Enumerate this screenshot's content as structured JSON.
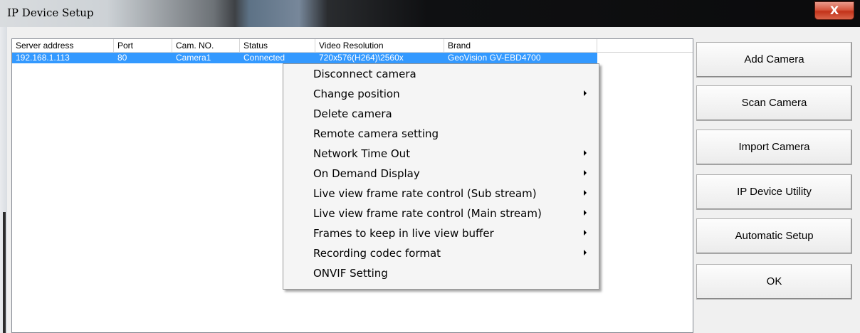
{
  "window": {
    "title": "IP Device Setup",
    "close_glyph": "X"
  },
  "list": {
    "columns": [
      "Server address",
      "Port",
      "Cam. NO.",
      "Status",
      "Video Resolution",
      "Brand"
    ],
    "rows": [
      {
        "server": "192.168.1.113",
        "port": "80",
        "cam": "Camera1",
        "status": "Connected",
        "resolution": "720x576(H264)\\2560x",
        "brand": "GeoVision GV-EBD4700"
      }
    ]
  },
  "context_menu": {
    "items": [
      {
        "label": "Disconnect camera",
        "submenu": false
      },
      {
        "label": "Change position",
        "submenu": true
      },
      {
        "label": "Delete camera",
        "submenu": false
      },
      {
        "label": "Remote camera setting",
        "submenu": false
      },
      {
        "label": "Network Time Out",
        "submenu": true
      },
      {
        "label": "On Demand Display",
        "submenu": true
      },
      {
        "label": "Live view frame rate control (Sub stream)",
        "submenu": true
      },
      {
        "label": "Live view frame rate control (Main stream)",
        "submenu": true
      },
      {
        "label": "Frames to keep in live view buffer",
        "submenu": true
      },
      {
        "label": "Recording codec format",
        "submenu": true
      },
      {
        "label": "ONVIF Setting",
        "submenu": false
      }
    ]
  },
  "buttons": [
    "Add Camera",
    "Scan Camera",
    "Import Camera",
    "IP Device Utility",
    "Automatic Setup",
    "OK"
  ],
  "colors": {
    "selection": "#3399ff",
    "close_button": "#c7462d"
  }
}
